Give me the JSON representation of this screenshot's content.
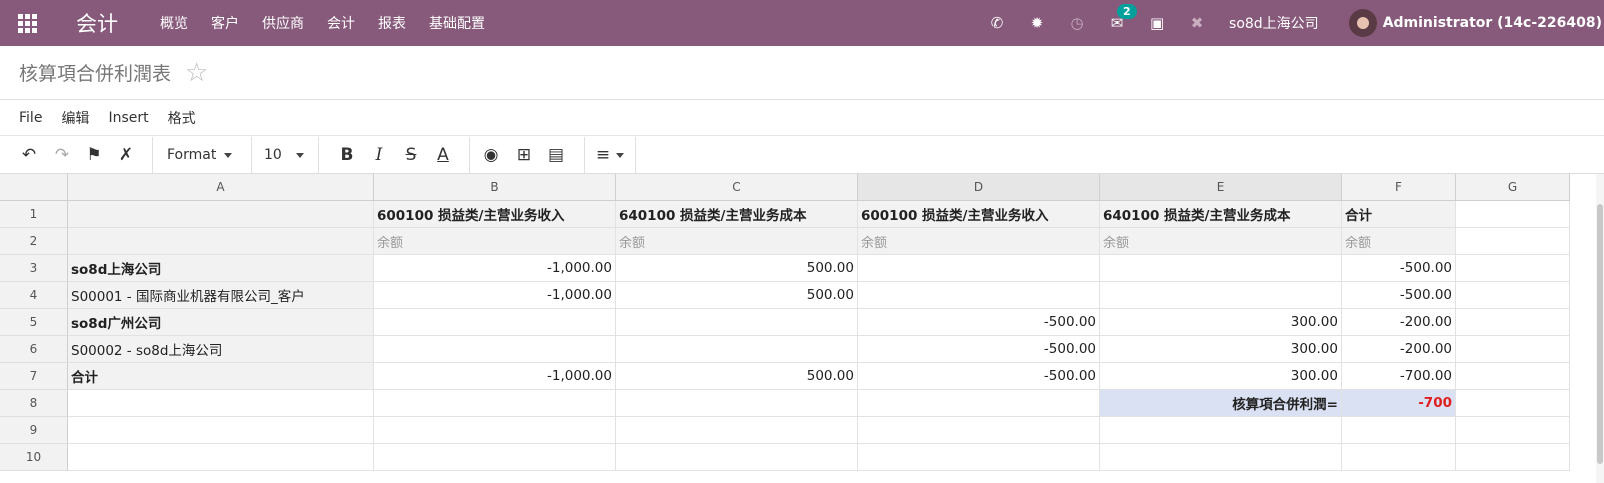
{
  "app": {
    "name": "会计"
  },
  "nav": {
    "menu": [
      "概览",
      "客户",
      "供应商",
      "会计",
      "报表",
      "基础配置"
    ]
  },
  "systray": {
    "message_count": "2",
    "company": "so8d上海公司",
    "user": "Administrator (14c-226408)"
  },
  "title": "核算項合併利潤表",
  "file_menu": [
    "File",
    "编辑",
    "Insert",
    "格式"
  ],
  "toolbar": {
    "format_label": "Format",
    "font_size": "10"
  },
  "sheet": {
    "columns": [
      "A",
      "B",
      "C",
      "D",
      "E",
      "F",
      "G"
    ],
    "rows": [
      "1",
      "2",
      "3",
      "4",
      "5",
      "6",
      "7",
      "8",
      "9",
      "10"
    ],
    "cells": [
      [
        "",
        "600100 损益类/主营业务收入",
        "640100 损益类/主营业务成本",
        "600100 损益类/主营业务收入",
        "640100 损益类/主营业务成本",
        "合计",
        ""
      ],
      [
        "",
        "余额",
        "余额",
        "余额",
        "余额",
        "余额",
        ""
      ],
      [
        "so8d上海公司",
        "-1,000.00",
        "500.00",
        "",
        "",
        "-500.00",
        ""
      ],
      [
        "S00001 - 国际商业机器有限公司_客户",
        "-1,000.00",
        "500.00",
        "",
        "",
        "-500.00",
        ""
      ],
      [
        "so8d广州公司",
        "",
        "",
        "-500.00",
        "300.00",
        "-200.00",
        ""
      ],
      [
        "S00002 - so8d上海公司",
        "",
        "",
        "-500.00",
        "300.00",
        "-200.00",
        ""
      ],
      [
        "合计",
        "-1,000.00",
        "500.00",
        "-500.00",
        "300.00",
        "-700.00",
        ""
      ],
      [
        "",
        "",
        "",
        "",
        "核算項合併利潤=",
        "-700",
        ""
      ],
      [
        "",
        "",
        "",
        "",
        "",
        "",
        ""
      ],
      [
        "",
        "",
        "",
        "",
        "",
        "",
        ""
      ]
    ]
  }
}
